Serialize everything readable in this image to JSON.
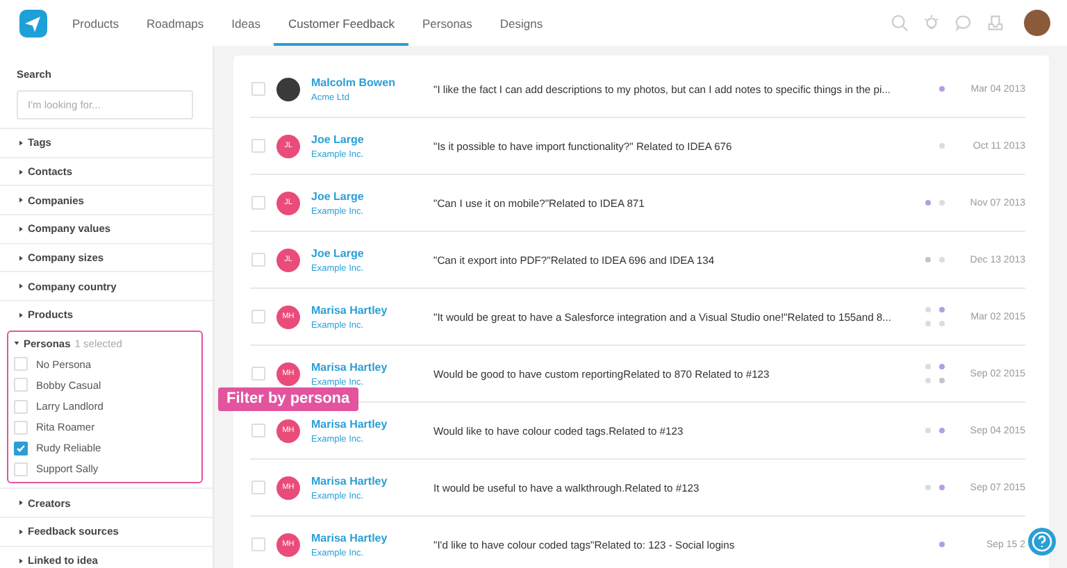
{
  "nav": {
    "tabs": [
      {
        "label": "Products",
        "selected": false
      },
      {
        "label": "Roadmaps",
        "selected": false
      },
      {
        "label": "Ideas",
        "selected": false
      },
      {
        "label": "Customer Feedback",
        "selected": true
      },
      {
        "label": "Personas",
        "selected": false
      },
      {
        "label": "Designs",
        "selected": false
      }
    ]
  },
  "sidebar": {
    "search_label": "Search",
    "search": {
      "placeholder": "I'm looking for..."
    },
    "filters_before": [
      {
        "label": "Tags",
        "expanded": false
      },
      {
        "label": "Contacts",
        "expanded": false
      },
      {
        "label": "Companies",
        "expanded": false
      },
      {
        "label": "Company values",
        "expanded": false
      },
      {
        "label": "Company sizes",
        "expanded": false
      },
      {
        "label": "Company country",
        "expanded": false
      },
      {
        "label": "Products",
        "expanded": false
      }
    ],
    "personas": {
      "label": "Personas",
      "count": "1 selected",
      "expanded": true,
      "options": [
        {
          "label": "No Persona",
          "checked": false
        },
        {
          "label": "Bobby Casual",
          "checked": false
        },
        {
          "label": "Larry Landlord",
          "checked": false
        },
        {
          "label": "Rita Roamer",
          "checked": false
        },
        {
          "label": "Rudy Reliable",
          "checked": true
        },
        {
          "label": "Support Sally",
          "checked": false
        }
      ]
    },
    "filters_after": [
      {
        "label": "Creators",
        "expanded": false
      },
      {
        "label": "Feedback sources",
        "expanded": false
      },
      {
        "label": "Linked to idea",
        "expanded": false
      }
    ]
  },
  "callout": "Filter by persona",
  "feedback": [
    {
      "name": "Malcolm Bowen",
      "company": "Acme Ltd",
      "checked": false,
      "avatar": {
        "kind": "photo"
      },
      "text": "\"I like the fact I can add descriptions to my photos, but can I add notes to specific things in the pi...",
      "dots": [
        {
          "color": "#b79be6"
        }
      ],
      "date": "Mar 04 2013"
    },
    {
      "name": "Joe Large",
      "company": "Example Inc.",
      "checked": false,
      "avatar": {
        "kind": "initials",
        "initials": "JL"
      },
      "text": "\"Is it possible to have import functionality?\" Related to IDEA 676",
      "dots": [
        {
          "color": "#dcdcdc"
        }
      ],
      "date": "Oct 11 2013"
    },
    {
      "name": "Joe Large",
      "company": "Example Inc.",
      "checked": false,
      "avatar": {
        "kind": "initials",
        "initials": "JL"
      },
      "text": "\"Can I use it on mobile?\"Related to IDEA 871",
      "dots": [
        {
          "color": "#b79be6"
        },
        {
          "color": "#dcdcdc"
        }
      ],
      "date": "Nov 07 2013"
    },
    {
      "name": "Joe Large",
      "company": "Example Inc.",
      "checked": false,
      "avatar": {
        "kind": "initials",
        "initials": "JL"
      },
      "text": "\"Can it export into PDF?\"Related to IDEA 696 and IDEA 134",
      "dots": [
        {
          "color": "#c4c4cc"
        },
        {
          "color": "#dcdcdc"
        }
      ],
      "date": "Dec 13 2013"
    },
    {
      "name": "Marisa Hartley",
      "company": "Example Inc.",
      "checked": false,
      "avatar": {
        "kind": "initials",
        "initials": "MH"
      },
      "text": "\"It would be great to have a Salesforce integration and a Visual Studio one!\"Related to 155and 8...",
      "dots": [
        {
          "color": "#dcdcdc"
        },
        {
          "color": "#b79be6"
        },
        {
          "color": "#dcdcdc"
        },
        {
          "color": "#dcdcdc"
        }
      ],
      "date": "Mar 02 2015"
    },
    {
      "name": "Marisa Hartley",
      "company": "Example Inc.",
      "checked": false,
      "avatar": {
        "kind": "initials",
        "initials": "MH"
      },
      "text": "Would be good to have custom reportingRelated to 870 Related to #123",
      "dots": [
        {
          "color": "#dcdcdc"
        },
        {
          "color": "#b79be6"
        },
        {
          "color": "#dcdcdc"
        },
        {
          "color": "#c4c4cc"
        }
      ],
      "date": "Sep 02 2015"
    },
    {
      "name": "Marisa Hartley",
      "company": "Example Inc.",
      "checked": false,
      "avatar": {
        "kind": "initials",
        "initials": "MH"
      },
      "text": "Would like to have colour coded tags.Related to #123",
      "dots": [
        {
          "color": "#dcdcdc"
        },
        {
          "color": "#b79be6"
        }
      ],
      "date": "Sep 04 2015"
    },
    {
      "name": "Marisa Hartley",
      "company": "Example Inc.",
      "checked": false,
      "avatar": {
        "kind": "initials",
        "initials": "MH"
      },
      "text": "It would be useful to have a walkthrough.Related to #123",
      "dots": [
        {
          "color": "#dcdcdc"
        },
        {
          "color": "#b79be6"
        }
      ],
      "date": "Sep 07 2015"
    },
    {
      "name": "Marisa Hartley",
      "company": "Example Inc.",
      "checked": false,
      "avatar": {
        "kind": "initials",
        "initials": "MH"
      },
      "text": "\"I'd like to have colour coded tags\"Related to: 123 - Social logins",
      "dots": [
        {
          "color": "#b79be6"
        }
      ],
      "date": "Sep 15 2"
    }
  ]
}
